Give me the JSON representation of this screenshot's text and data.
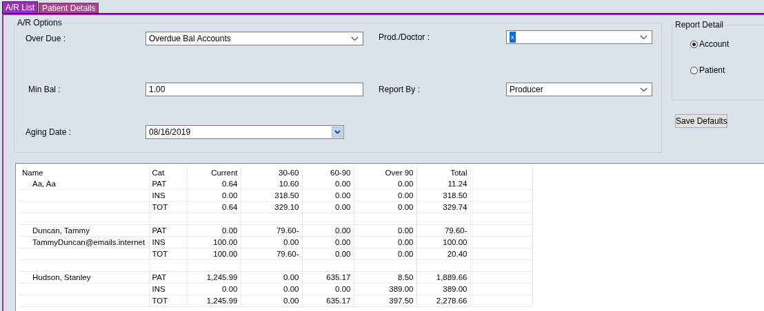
{
  "tabs": [
    {
      "label": "A/R List",
      "selected": true
    },
    {
      "label": "Patient Details",
      "selected": false
    }
  ],
  "ar_options": {
    "title": "A/R Options",
    "fields": [
      {
        "label": "Over Due :",
        "kind": "dropdown",
        "value": "Overdue Bal Accounts"
      },
      {
        "label": "Prod./Doctor :",
        "kind": "dropdown",
        "value": "x",
        "highlighted": true
      },
      {
        "label": "Min Bal :",
        "kind": "text",
        "value": "1.00"
      },
      {
        "label": "Report By :",
        "kind": "dropdown",
        "value": "Producer"
      },
      {
        "label": "Aging Date :",
        "kind": "date",
        "value": "08/16/2019"
      }
    ]
  },
  "report_detail": {
    "title": "Report Detail",
    "options": [
      {
        "label": "Account",
        "selected": true
      },
      {
        "label": "Patient",
        "selected": false
      }
    ]
  },
  "save_button": "Save Defaults",
  "table": {
    "columns": [
      "Name",
      "Cat",
      "Current",
      "30-60",
      "60-90",
      "Over 90",
      "Total"
    ],
    "rows": [
      {
        "kind": "data",
        "name": "Aa, Aa",
        "cat": "PAT",
        "values": [
          "0.64",
          "10.60",
          "0.00",
          "0.00",
          "11.24"
        ]
      },
      {
        "kind": "data",
        "cat": "INS",
        "values": [
          "0.00",
          "318.50",
          "0.00",
          "0.00",
          "318.50"
        ]
      },
      {
        "kind": "data",
        "cat": "TOT",
        "values": [
          "0.64",
          "329.10",
          "0.00",
          "0.00",
          "329.74"
        ]
      },
      {
        "kind": "blank"
      },
      {
        "kind": "data",
        "name": "Duncan, Tammy",
        "cat": "PAT",
        "values": [
          "0.00",
          "79.60-",
          "0.00",
          "0.00",
          "79.60-"
        ]
      },
      {
        "kind": "data",
        "name": "TammyDuncan@emails.internet",
        "cat": "INS",
        "values": [
          "100.00",
          "0.00",
          "0.00",
          "0.00",
          "100.00"
        ]
      },
      {
        "kind": "data",
        "cat": "TOT",
        "values": [
          "100.00",
          "79.60-",
          "0.00",
          "0.00",
          "20.40"
        ]
      },
      {
        "kind": "blank"
      },
      {
        "kind": "data",
        "name": "Hudson, Stanley",
        "cat": "PAT",
        "values": [
          "1,245.99",
          "0.00",
          "635.17",
          "8.50",
          "1,889.66"
        ]
      },
      {
        "kind": "data",
        "cat": "INS",
        "values": [
          "0.00",
          "0.00",
          "0.00",
          "389.00",
          "389.00"
        ]
      },
      {
        "kind": "data",
        "cat": "TOT",
        "values": [
          "1,245.99",
          "0.00",
          "635.17",
          "397.50",
          "2,278.66"
        ]
      }
    ]
  }
}
